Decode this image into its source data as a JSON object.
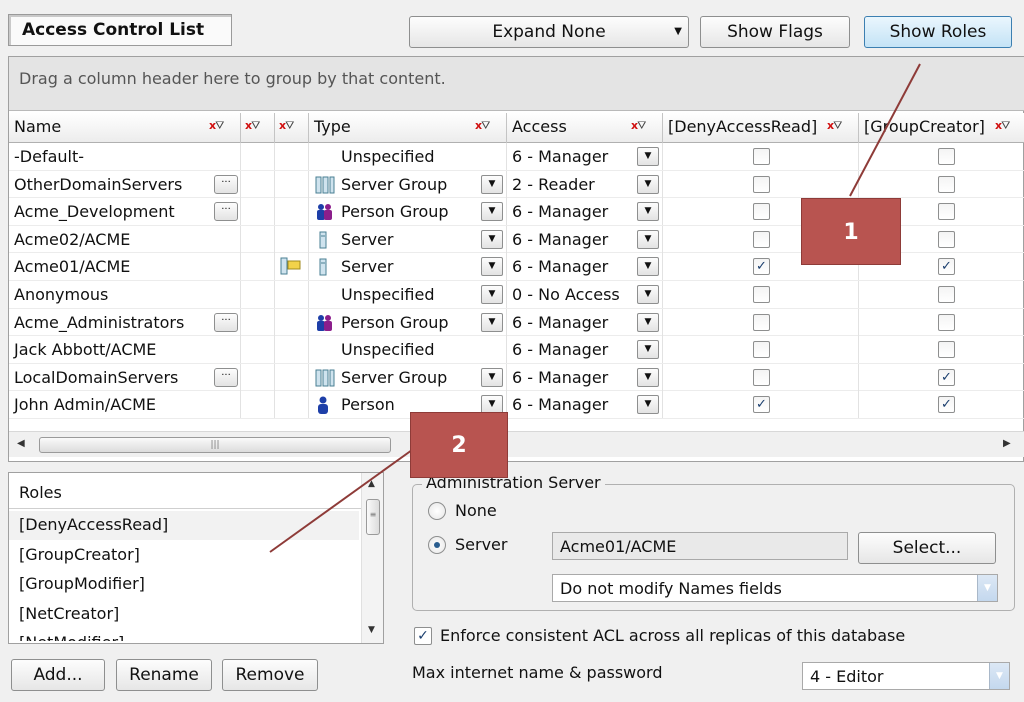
{
  "title": "Access Control List",
  "toolbar": {
    "expand_label": "Expand None",
    "show_flags_label": "Show Flags",
    "show_roles_label": "Show Roles"
  },
  "grid": {
    "group_hint": "Drag a column header here to group by that content.",
    "columns": {
      "name": "Name",
      "type": "Type",
      "access": "Access",
      "deny_access_read": "[DenyAccessRead]",
      "group_creator": "[GroupCreator]"
    },
    "rows": [
      {
        "name": "-Default-",
        "type": "Unspecified",
        "access": "6 - Manager",
        "deny": false,
        "group_creator": false
      },
      {
        "name": "OtherDomainServers",
        "type": "Server Group",
        "access": "2 - Reader",
        "deny": false,
        "group_creator": false
      },
      {
        "name": "Acme_Development",
        "type": "Person Group",
        "access": "6 - Manager",
        "deny": false,
        "group_creator": false
      },
      {
        "name": "Acme02/ACME",
        "type": "Server",
        "access": "6 - Manager",
        "deny": false,
        "group_creator": false
      },
      {
        "name": "Acme01/ACME",
        "type": "Server",
        "access": "6 - Manager",
        "deny": true,
        "group_creator": true
      },
      {
        "name": "Anonymous",
        "type": "Unspecified",
        "access": "0 - No Access",
        "deny": false,
        "group_creator": false
      },
      {
        "name": "Acme_Administrators",
        "type": "Person Group",
        "access": "6 - Manager",
        "deny": false,
        "group_creator": false
      },
      {
        "name": "Jack Abbott/ACME",
        "type": "Unspecified",
        "access": "6 - Manager",
        "deny": false,
        "group_creator": false
      },
      {
        "name": "LocalDomainServers",
        "type": "Server Group",
        "access": "6 - Manager",
        "deny": false,
        "group_creator": true
      },
      {
        "name": "John Admin/ACME",
        "type": "Person",
        "access": "6 - Manager",
        "deny": true,
        "group_creator": true
      }
    ]
  },
  "roles": {
    "header": "Roles",
    "items": [
      "[DenyAccessRead]",
      "[GroupCreator]",
      "[GroupModifier]",
      "[NetCreator]",
      "[NetModifier]"
    ]
  },
  "role_buttons": {
    "add": "Add...",
    "rename": "Rename",
    "remove": "Remove"
  },
  "admin_server": {
    "legend": "Administration Server",
    "none_label": "None",
    "server_label": "Server",
    "server_value": "Acme01/ACME",
    "select_label": "Select...",
    "names_option": "Do not modify Names fields"
  },
  "enforce_label": "Enforce consistent ACL across all replicas of this database",
  "max_internet_label": "Max internet name & password",
  "max_internet_value": "4 - Editor",
  "callouts": {
    "one": "1",
    "two": "2"
  },
  "colors": {
    "callout": "#b85450",
    "accent": "#3c7fb1"
  }
}
